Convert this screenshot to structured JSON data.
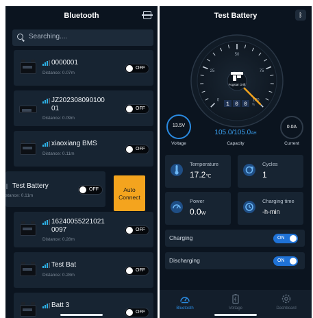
{
  "left": {
    "title": "Bluetooth",
    "search": {
      "placeholder": "Searching...."
    },
    "toggle_off_label": "OFF",
    "devices": [
      {
        "name": "0000001",
        "distance": "Distance: 0.07m"
      },
      {
        "name": "JZ202308090100",
        "name2": "01",
        "distance": "Distance: 0.09m"
      },
      {
        "name": "xiaoxiang BMS",
        "distance": "Distance: 0.11m"
      },
      {
        "name": "Test Battery",
        "distance": "stance: 0.11m"
      },
      {
        "name": "16240055221021",
        "name2": "0097",
        "distance": "Distance: 0.28m"
      },
      {
        "name": "Test Bat",
        "distance": "Distance: 0.28m"
      },
      {
        "name": "Batt 3"
      }
    ],
    "auto_connect": {
      "line1": "Auto",
      "line2": "Connect"
    }
  },
  "right": {
    "title": "Test Battery",
    "gauge": {
      "ticks": [
        "0",
        "25",
        "50",
        "75",
        "100"
      ],
      "brand": "Fogstar Drift",
      "digits": [
        "1",
        "0",
        "0"
      ],
      "unit": "%",
      "level_percent": 100
    },
    "voltage": {
      "value": "13.5V",
      "label": "Voltage"
    },
    "capacity": {
      "value": "105.0/105.0",
      "unit": "AH",
      "label": "Capacity"
    },
    "current": {
      "value": "0.0A",
      "label": "Current"
    },
    "temperature": {
      "label": "Temperature",
      "value": "17.2",
      "unit": "℃"
    },
    "cycles": {
      "label": "Cycles",
      "value": "1"
    },
    "power": {
      "label": "Power",
      "value": "0.0",
      "unit": "W"
    },
    "charging_time": {
      "label": "Charging time",
      "value": "-h-min"
    },
    "charging": {
      "label": "Charging",
      "toggle": "ON"
    },
    "discharging": {
      "label": "Discharging",
      "toggle": "ON"
    },
    "tabs": [
      "Bluetooth",
      "Voltage",
      "Dashboard"
    ]
  },
  "colors": {
    "background": "#0b141f",
    "card": "#172432",
    "accent_blue": "#2a8ae0",
    "signal": "#2db1e6",
    "auto_connect": "#f4a41e",
    "gauge_needle": "#f4a41e"
  }
}
